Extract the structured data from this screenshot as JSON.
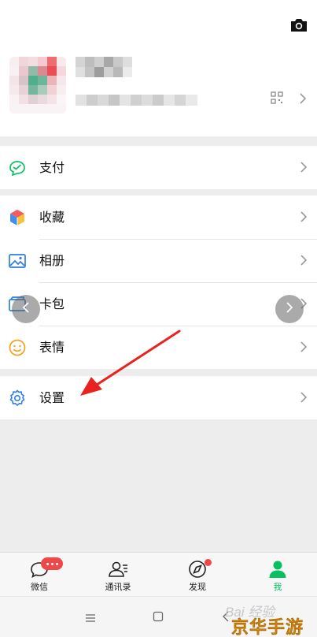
{
  "menu": {
    "pay": "支付",
    "favorites": "收藏",
    "album": "相册",
    "cards": "卡包",
    "stickers": "表情",
    "settings": "设置"
  },
  "tabbar": {
    "chats": "微信",
    "contacts": "通讯录",
    "discover": "发现",
    "me": "我"
  },
  "watermark": {
    "baidu": "Bai 经验",
    "site": "京华手游网"
  },
  "colors": {
    "accent": "#07c160",
    "badge": "#f04848",
    "arrow": "#e8231f"
  },
  "icons": [
    "camera-icon",
    "qr-code-icon",
    "pay-icon",
    "favorites-icon",
    "album-icon",
    "cards-icon",
    "stickers-icon",
    "settings-icon",
    "chat-icon",
    "contacts-icon",
    "discover-icon",
    "me-icon"
  ]
}
